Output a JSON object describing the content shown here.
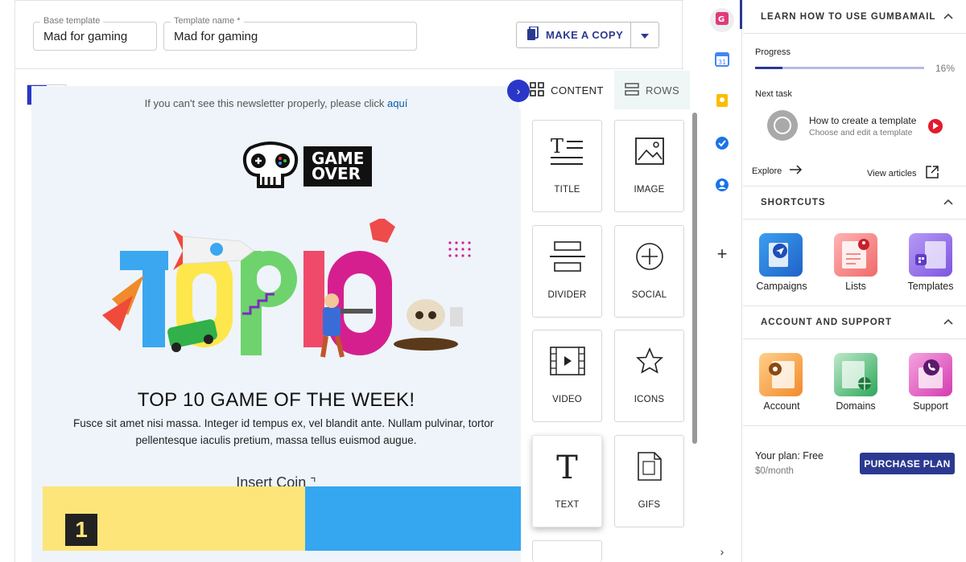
{
  "editor": {
    "base_template": {
      "label": "Base template",
      "value": "Mad for gaming"
    },
    "template_name": {
      "label": "Template name *",
      "value": "Mad for gaming"
    },
    "copy_button": "MAKE A COPY"
  },
  "email": {
    "preheader_text": "If you can't see this newsletter properly, please click",
    "preheader_link": "aquí",
    "logo_text_line1": "GAME",
    "logo_text_line2": "OVER",
    "hero_text": "TOP10",
    "headline": "TOP 10 GAME OF THE WEEK!",
    "body_line1": "Fusce sit amet nisi massa. Integer id tempus ex, vel blandit ante. Nullam pulvinar, tortor",
    "body_line2": "pellentesque iaculis pretium, massa tellus euismod augue.",
    "insert_coin": "Insert Coin",
    "rank_number": "1"
  },
  "panel": {
    "tabs": [
      "CONTENT",
      "ROWS"
    ],
    "blocks": [
      "TITLE",
      "IMAGE",
      "DIVIDER",
      "SOCIAL",
      "VIDEO",
      "ICONS",
      "TEXT",
      "GIFS"
    ]
  },
  "sidebar": {
    "learn_header": "LEARN HOW TO USE GUMBAMAIL",
    "progress_label": "Progress",
    "progress_percent": "16%",
    "progress_value": 0.16,
    "next_task_label": "Next task",
    "task_title": "How to create a template",
    "task_subtitle": "Choose and edit a template",
    "explore": "Explore",
    "view_articles": "View articles",
    "shortcuts_header": "SHORTCUTS",
    "shortcuts": [
      "Campaigns",
      "Lists",
      "Templates"
    ],
    "account_header": "ACCOUNT AND SUPPORT",
    "account_items": [
      "Account",
      "Domains",
      "Support"
    ],
    "plan_label": "Your plan: Free",
    "plan_price": "$0/month",
    "purchase": "PURCHASE PLAN"
  },
  "rail": {
    "calendar_day": "31"
  },
  "colors": {
    "accent": "#2b3990",
    "canvas": "#eef4fa",
    "tile_yellow": "#fde57a",
    "tile_blue": "#35a6f0"
  }
}
